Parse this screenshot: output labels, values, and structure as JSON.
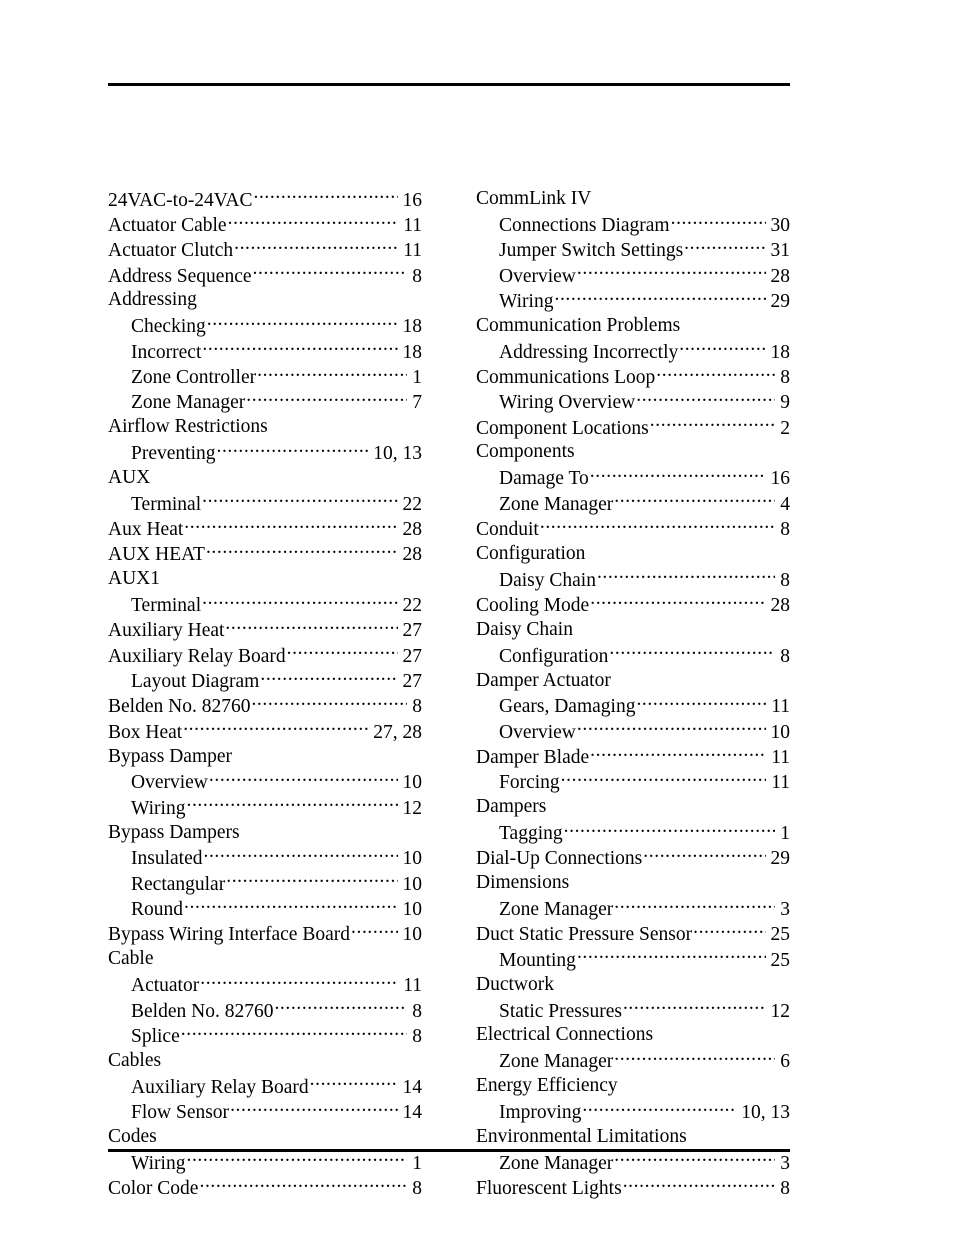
{
  "document": {
    "type": "index",
    "header_rule": true,
    "footer_rule": true
  },
  "index": {
    "left_column": [
      {
        "label": "24VAC-to-24VAC",
        "page": "16",
        "sub": false
      },
      {
        "label": "Actuator Cable",
        "page": "11",
        "sub": false
      },
      {
        "label": "Actuator Clutch",
        "page": "11",
        "sub": false
      },
      {
        "label": "Address Sequence",
        "page": "8",
        "sub": false
      },
      {
        "label": "Addressing",
        "page": "",
        "sub": false
      },
      {
        "label": "Checking",
        "page": "18",
        "sub": true
      },
      {
        "label": "Incorrect",
        "page": "18",
        "sub": true
      },
      {
        "label": "Zone Controller",
        "page": "1",
        "sub": true
      },
      {
        "label": "Zone Manager",
        "page": "7",
        "sub": true
      },
      {
        "label": "Airflow Restrictions",
        "page": "",
        "sub": false
      },
      {
        "label": "Preventing",
        "page": "10, 13",
        "sub": true
      },
      {
        "label": "AUX",
        "page": "",
        "sub": false
      },
      {
        "label": "Terminal",
        "page": "22",
        "sub": true
      },
      {
        "label": "Aux Heat",
        "page": "28",
        "sub": false
      },
      {
        "label": "AUX HEAT",
        "page": "28",
        "sub": false
      },
      {
        "label": "AUX1",
        "page": "",
        "sub": false
      },
      {
        "label": "Terminal",
        "page": "22",
        "sub": true
      },
      {
        "label": "Auxiliary Heat",
        "page": "27",
        "sub": false
      },
      {
        "label": "Auxiliary Relay Board",
        "page": "27",
        "sub": false
      },
      {
        "label": "Layout Diagram",
        "page": "27",
        "sub": true
      },
      {
        "label": "Belden No. 82760",
        "page": "8",
        "sub": false
      },
      {
        "label": "Box Heat",
        "page": "27, 28",
        "sub": false
      },
      {
        "label": "Bypass Damper",
        "page": "",
        "sub": false
      },
      {
        "label": "Overview",
        "page": "10",
        "sub": true
      },
      {
        "label": "Wiring",
        "page": "12",
        "sub": true
      },
      {
        "label": "Bypass Dampers",
        "page": "",
        "sub": false
      },
      {
        "label": "Insulated",
        "page": "10",
        "sub": true
      },
      {
        "label": "Rectangular",
        "page": "10",
        "sub": true
      },
      {
        "label": "Round",
        "page": "10",
        "sub": true
      },
      {
        "label": "Bypass Wiring Interface Board",
        "page": "10",
        "sub": false
      },
      {
        "label": "Cable",
        "page": "",
        "sub": false
      },
      {
        "label": "Actuator",
        "page": "11",
        "sub": true
      },
      {
        "label": "Belden No. 82760",
        "page": "8",
        "sub": true
      },
      {
        "label": "Splice",
        "page": "8",
        "sub": true
      },
      {
        "label": "Cables",
        "page": "",
        "sub": false
      },
      {
        "label": "Auxiliary Relay Board",
        "page": "14",
        "sub": true
      },
      {
        "label": "Flow Sensor",
        "page": "14",
        "sub": true
      },
      {
        "label": "Codes",
        "page": "",
        "sub": false
      },
      {
        "label": "Wiring",
        "page": "1",
        "sub": true
      },
      {
        "label": "Color Code",
        "page": "8",
        "sub": false
      }
    ],
    "right_column": [
      {
        "label": "CommLink IV",
        "page": "",
        "sub": false
      },
      {
        "label": "Connections Diagram",
        "page": "30",
        "sub": true
      },
      {
        "label": "Jumper Switch Settings",
        "page": "31",
        "sub": true
      },
      {
        "label": "Overview",
        "page": "28",
        "sub": true
      },
      {
        "label": "Wiring",
        "page": "29",
        "sub": true
      },
      {
        "label": "Communication Problems",
        "page": "",
        "sub": false
      },
      {
        "label": "Addressing Incorrectly",
        "page": "18",
        "sub": true
      },
      {
        "label": "Communications Loop",
        "page": "8",
        "sub": false
      },
      {
        "label": "Wiring Overview",
        "page": "9",
        "sub": true
      },
      {
        "label": "Component Locations",
        "page": "2",
        "sub": false
      },
      {
        "label": "Components",
        "page": "",
        "sub": false
      },
      {
        "label": "Damage To",
        "page": "16",
        "sub": true
      },
      {
        "label": "Zone Manager",
        "page": "4",
        "sub": true
      },
      {
        "label": "Conduit",
        "page": "8",
        "sub": false
      },
      {
        "label": "Configuration",
        "page": "",
        "sub": false
      },
      {
        "label": "Daisy Chain",
        "page": "8",
        "sub": true
      },
      {
        "label": "Cooling Mode",
        "page": "28",
        "sub": false
      },
      {
        "label": "Daisy Chain",
        "page": "",
        "sub": false
      },
      {
        "label": "Configuration",
        "page": "8",
        "sub": true
      },
      {
        "label": "Damper Actuator",
        "page": "",
        "sub": false
      },
      {
        "label": "Gears, Damaging",
        "page": "11",
        "sub": true
      },
      {
        "label": "Overview",
        "page": "10",
        "sub": true
      },
      {
        "label": "Damper Blade",
        "page": "11",
        "sub": false
      },
      {
        "label": "Forcing",
        "page": "11",
        "sub": true
      },
      {
        "label": "Dampers",
        "page": "",
        "sub": false
      },
      {
        "label": "Tagging",
        "page": "1",
        "sub": true
      },
      {
        "label": "Dial-Up Connections",
        "page": "29",
        "sub": false
      },
      {
        "label": "Dimensions",
        "page": "",
        "sub": false
      },
      {
        "label": "Zone Manager",
        "page": "3",
        "sub": true
      },
      {
        "label": "Duct Static Pressure Sensor",
        "page": "25",
        "sub": false
      },
      {
        "label": "Mounting",
        "page": "25",
        "sub": true
      },
      {
        "label": "Ductwork",
        "page": "",
        "sub": false
      },
      {
        "label": "Static Pressures",
        "page": "12",
        "sub": true
      },
      {
        "label": "Electrical Connections",
        "page": "",
        "sub": false
      },
      {
        "label": "Zone Manager",
        "page": "6",
        "sub": true
      },
      {
        "label": "Energy Efficiency",
        "page": "",
        "sub": false
      },
      {
        "label": "Improving",
        "page": "10, 13",
        "sub": true
      },
      {
        "label": "Environmental Limitations",
        "page": "",
        "sub": false
      },
      {
        "label": "Zone Manager",
        "page": "3",
        "sub": true
      },
      {
        "label": "Fluorescent Lights",
        "page": "8",
        "sub": false
      }
    ]
  }
}
